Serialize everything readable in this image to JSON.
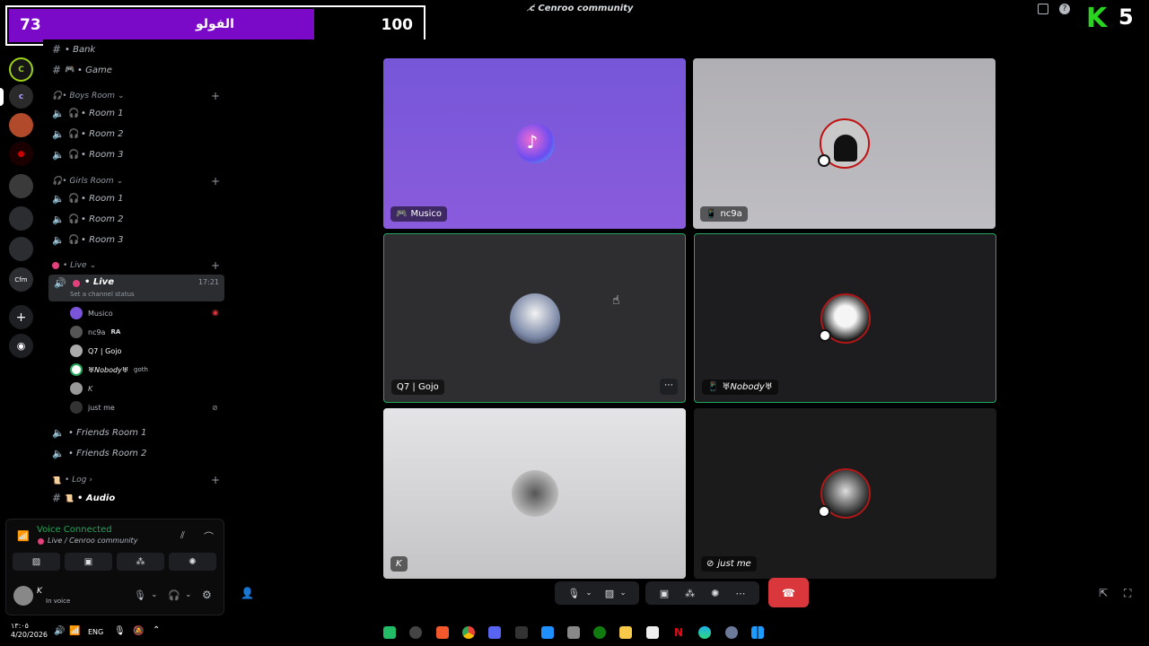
{
  "window": {
    "title": "Cenroo community"
  },
  "score": {
    "left_value": "73",
    "label": "الفولو",
    "right_value": "100"
  },
  "brand": {
    "letter": "K",
    "number": "5"
  },
  "sidebar": {
    "top_channels": [
      {
        "name": "• Bank"
      },
      {
        "name": "• Game"
      }
    ],
    "boys_category": "• Boys Room",
    "boys_rooms": [
      "• Room 1",
      "• Room 2",
      "• Room 3"
    ],
    "girls_category": "• Girls Room",
    "girls_rooms": [
      "• Room 1",
      "• Room 2",
      "• Room 3"
    ],
    "live_category": "• Live",
    "live_channel": {
      "name": "• Live",
      "time": "17:21",
      "status": "Set a channel status"
    },
    "members": [
      {
        "name": "Musico",
        "tag": ""
      },
      {
        "name": "nc9a",
        "tag": "RA"
      },
      {
        "name": "Q7 | Gojo",
        "tag": ""
      },
      {
        "name": "♅Nobody♅",
        "tag": "goth"
      },
      {
        "name": "K",
        "tag": ""
      },
      {
        "name": "just me",
        "tag": ""
      }
    ],
    "friends_rooms": [
      "• Friends Room 1",
      "• Friends Room 2"
    ],
    "log_category": "• Log",
    "audio_channel": "• Audio"
  },
  "voice_panel": {
    "status": "Voice Connected",
    "location": "Live / Cenroo community",
    "user_name": "K",
    "user_status": "In voice"
  },
  "tiles": [
    {
      "label": "Musico",
      "bg": "#7b55d9"
    },
    {
      "label": "nc9a",
      "bg": "#b4b3b8"
    },
    {
      "label": "Q7 | Gojo",
      "bg": "#2f2f31"
    },
    {
      "label": "♅Nobody♅",
      "bg": "#1d1d1f"
    },
    {
      "label": "K",
      "bg": "#d6d6d8"
    },
    {
      "label": "just me",
      "bg": "#1b1b1c"
    }
  ],
  "taskbar": {
    "time": "١٣:٠٥",
    "date": "4/20/2026",
    "lang": "ENG"
  },
  "colors": {
    "accent_purple": "#7a09c8",
    "speaking_green": "#23a55a",
    "disconnect_red": "#da373c"
  }
}
